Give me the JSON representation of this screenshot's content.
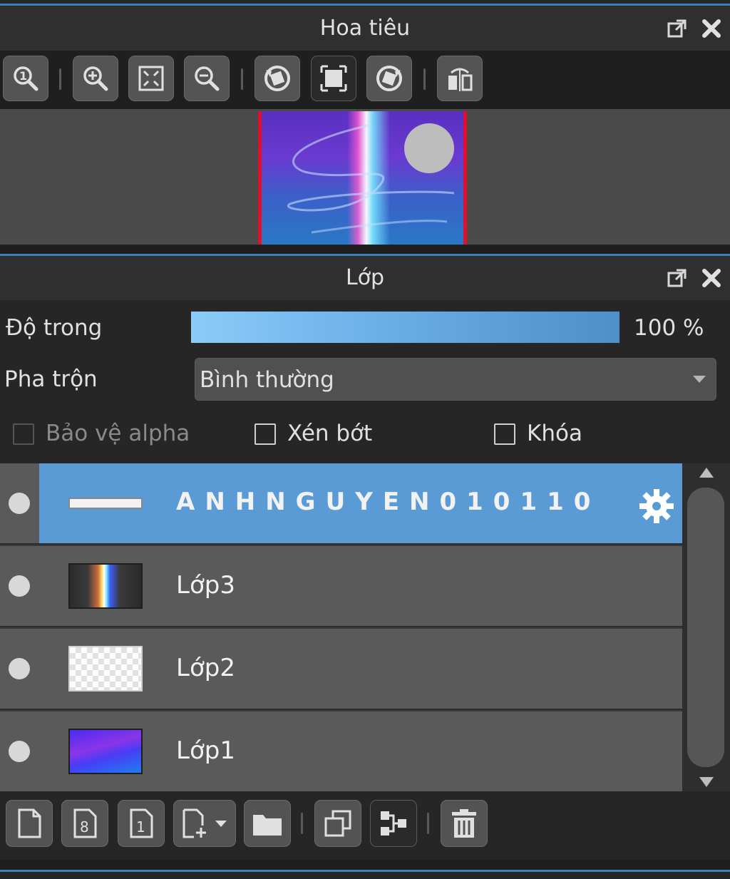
{
  "navigator": {
    "title": "Hoa tiêu",
    "icons": [
      "popout-icon",
      "close-icon"
    ],
    "toolbar": [
      "zoom-actual-icon",
      "zoom-in-icon",
      "fit-screen-icon",
      "zoom-out-icon",
      "rotate-left-icon",
      "fullscreen-icon",
      "rotate-right-icon",
      "flip-icon"
    ]
  },
  "layers_panel": {
    "title": "Lớp",
    "opacity_label": "Độ trong",
    "opacity_value": "100 %",
    "opacity_fraction": 1.0,
    "blend_label": "Pha trộn",
    "blend_value": "Bình thường",
    "protect_alpha_label": "Bảo vệ alpha",
    "clip_label": "Xén bớt",
    "lock_label": "Khóa",
    "layers": [
      {
        "name": "ANHNGUYEN010110",
        "selected": true
      },
      {
        "name": "Lớp3",
        "selected": false
      },
      {
        "name": "Lớp2",
        "selected": false
      },
      {
        "name": "Lớp1",
        "selected": false
      }
    ],
    "bottom_toolbar": [
      "new-layer-icon",
      "new-layer-8bit-icon",
      "new-layer-1bit-icon",
      "add-layer-dropdown-icon",
      "new-folder-icon",
      "duplicate-layer-icon",
      "merge-layer-icon",
      "delete-layer-icon"
    ]
  },
  "colors": {
    "accent": "#5b9bd5",
    "bg": "#262626",
    "row": "#5a5a5a"
  }
}
